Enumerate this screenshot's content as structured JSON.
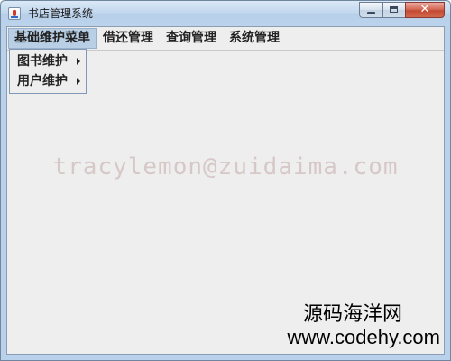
{
  "window": {
    "title": "书店管理系统"
  },
  "menubar": {
    "menus": [
      {
        "label": "基础维护菜单"
      },
      {
        "label": "借还管理"
      },
      {
        "label": "查询管理"
      },
      {
        "label": "系统管理"
      }
    ]
  },
  "popup": {
    "items": [
      {
        "label": "图书维护"
      },
      {
        "label": "用户维护"
      }
    ]
  },
  "watermark": {
    "text": "tracylemon@zuidaima.com"
  },
  "site_badge": {
    "name": "源码海洋网",
    "url": "www.codehy.com"
  },
  "colors": {
    "client_background": "#eeeeee",
    "active_menu": "#b8cfe5",
    "close_button": "#c44a33",
    "watermark": "#d7c8c8"
  },
  "icons": [
    "java-app-icon",
    "minimize-icon",
    "maximize-icon",
    "close-icon",
    "submenu-arrow-icon"
  ]
}
